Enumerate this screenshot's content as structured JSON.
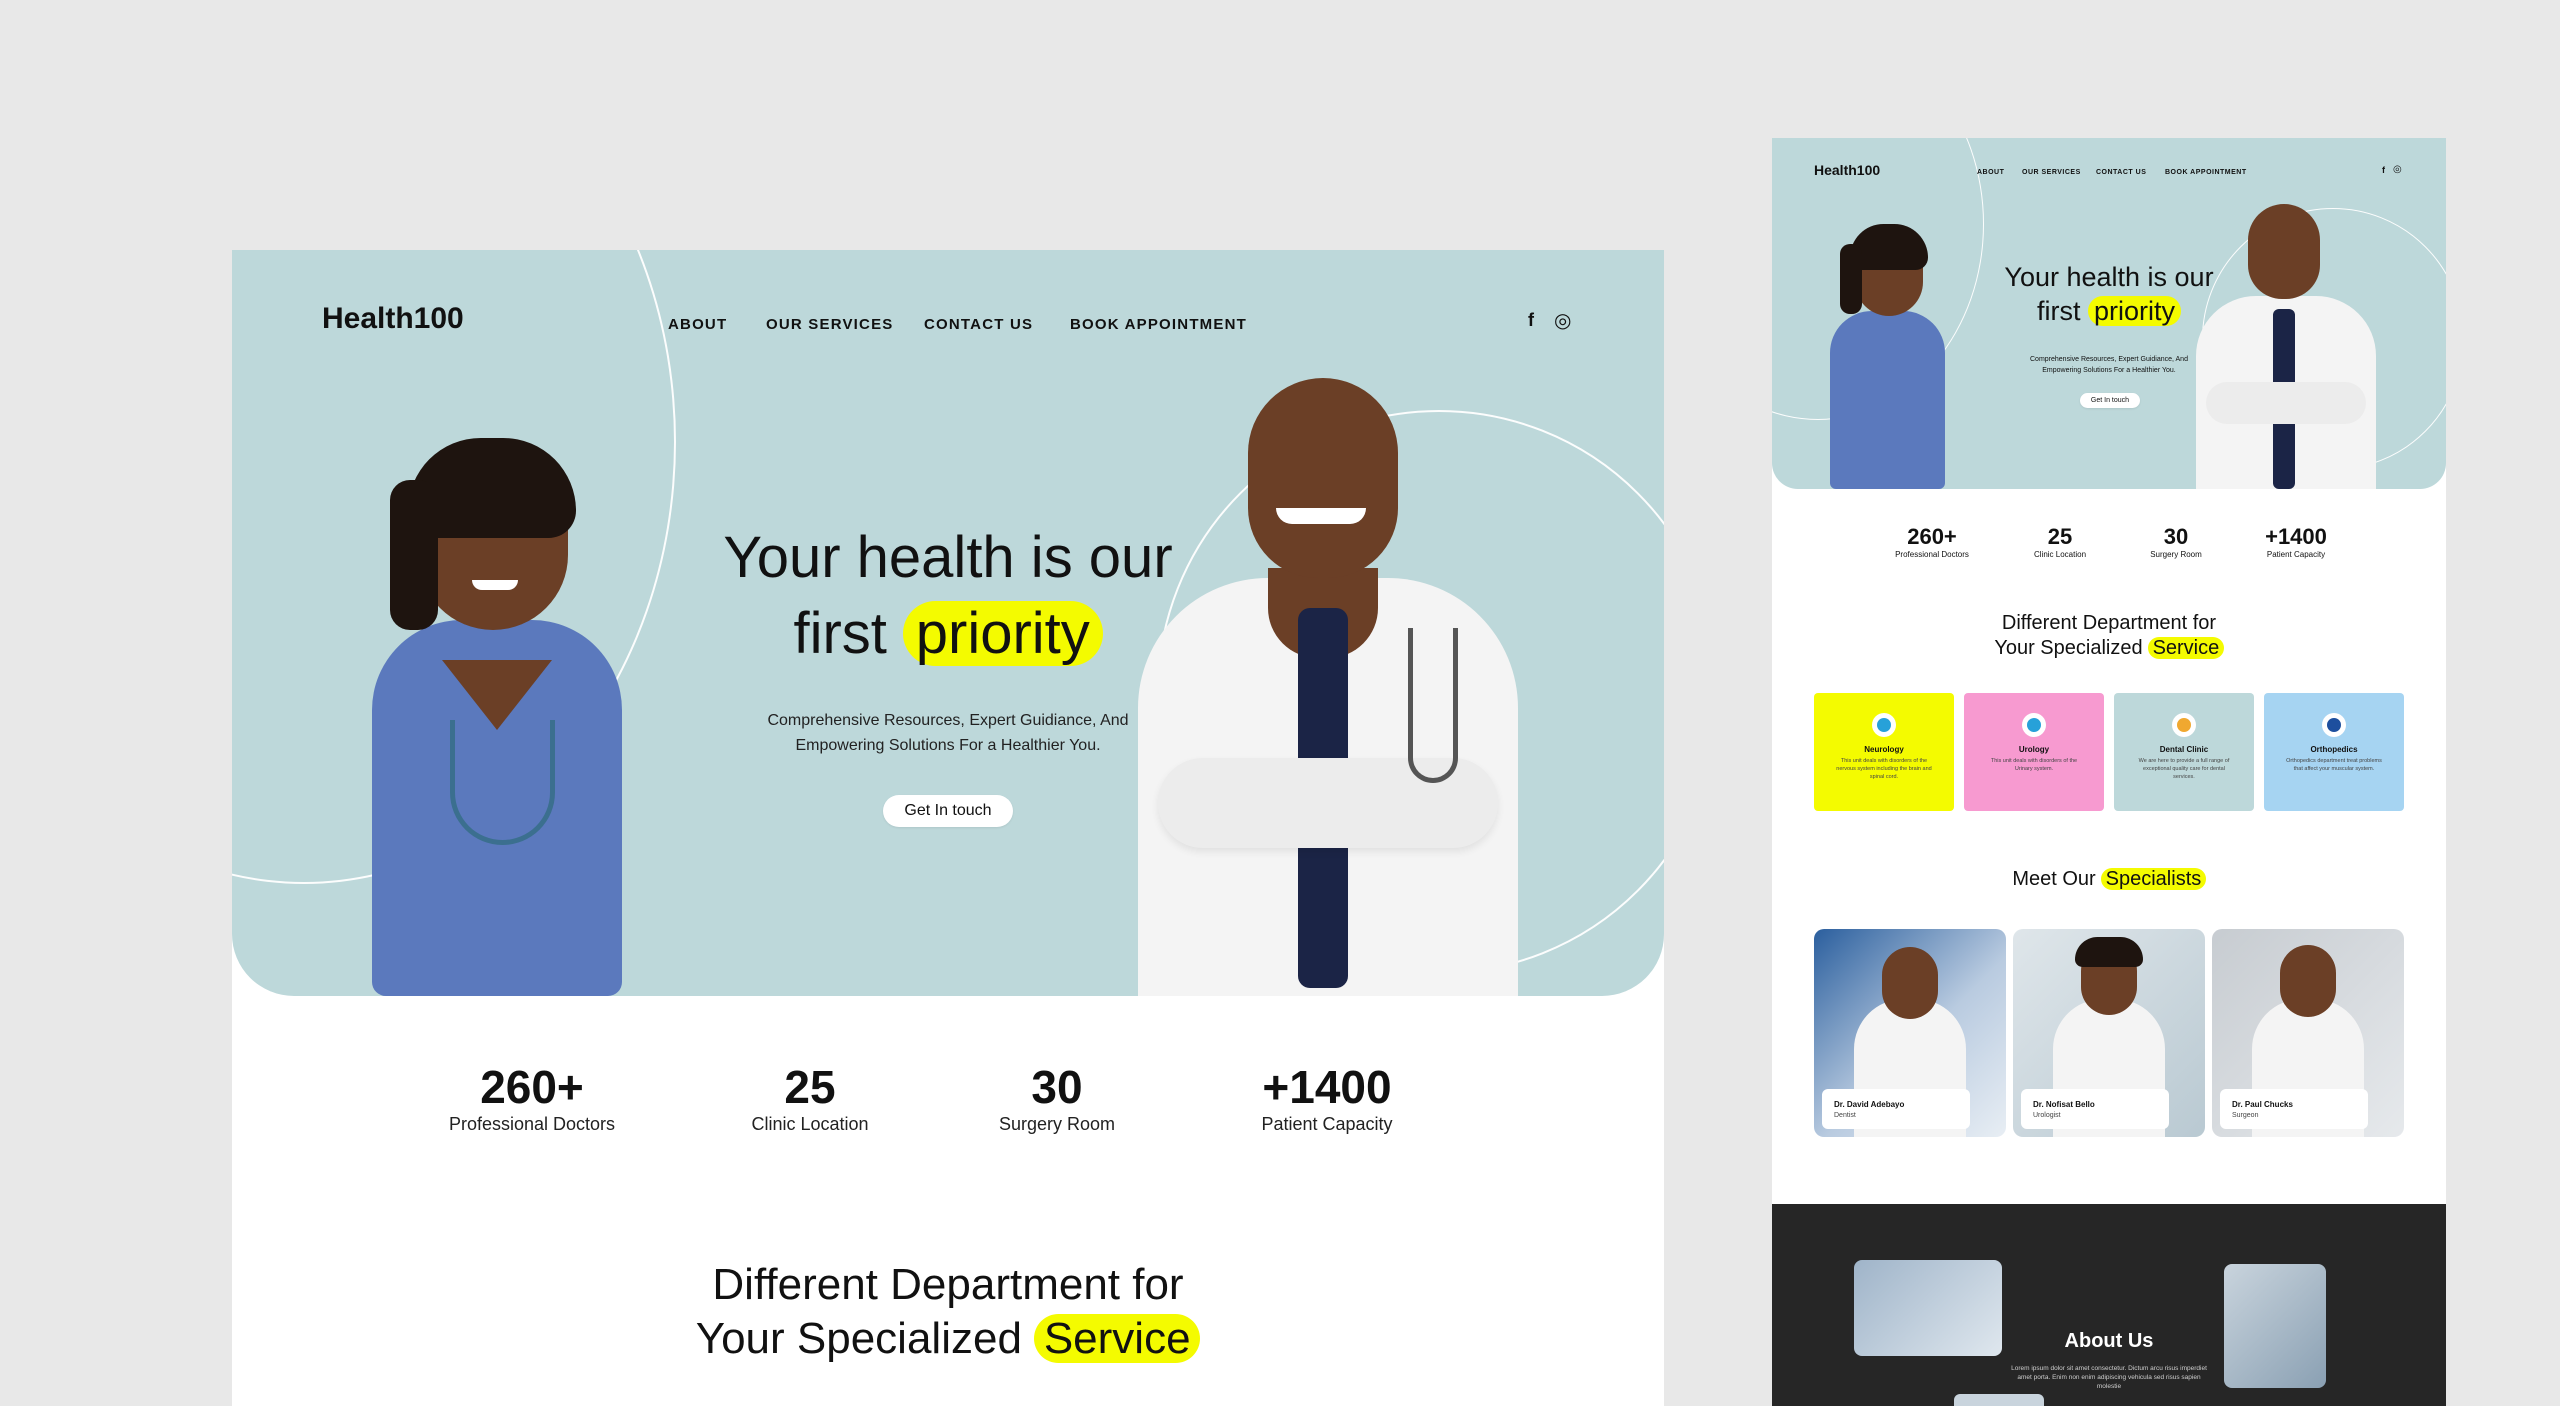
{
  "brand": {
    "name": "Health100"
  },
  "nav": {
    "about": "ABOUT",
    "services": "OUR SERVICES",
    "contact": "CONTACT US",
    "book": "BOOK APPOINTMENT"
  },
  "social": {
    "facebook": "f",
    "instagram": "◎"
  },
  "hero": {
    "title_line1": "Your health is our",
    "title_line2_pre": "first",
    "title_highlight": "priority",
    "subtitle_line1": "Comprehensive Resources, Expert Guidiance, And",
    "subtitle_line2": "Empowering Solutions For a Healthier You.",
    "cta": "Get In touch"
  },
  "stats": [
    {
      "value": "260+",
      "label": "Professional Doctors"
    },
    {
      "value": "25",
      "label": "Clinic Location"
    },
    {
      "value": "30",
      "label": "Surgery Room"
    },
    {
      "value": "+1400",
      "label": "Patient Capacity"
    }
  ],
  "departments_section": {
    "title_line1": "Different Department for",
    "title_line2_pre": "Your Specialized",
    "title_highlight": "Service"
  },
  "departments": [
    {
      "name": "Neurology",
      "desc": "This unit deals with disorders of the nervous system including the brain and spinal cord.",
      "color": "#f4fb00",
      "icon_color": "#27a1d9"
    },
    {
      "name": "Urology",
      "desc": "This unit deals with disorders of the Urinary system.",
      "color": "#f79ad0",
      "icon_color": "#27a1d9"
    },
    {
      "name": "Dental Clinic",
      "desc": "We are here to provide a full range of exceptional quality care for dental services.",
      "color": "#bdd8da",
      "icon_color": "#f0a830"
    },
    {
      "name": "Orthopedics",
      "desc": "Orthopedics department treat problems that affect your muscular system.",
      "color": "#a6d4f2",
      "icon_color": "#1d4f9e"
    }
  ],
  "specialists_section": {
    "title_pre": "Meet Our",
    "title_highlight": "Specialists"
  },
  "specialists": [
    {
      "name": "Dr. David Adebayo",
      "role": "Dentist"
    },
    {
      "name": "Dr. Nofisat Bello",
      "role": "Urologist"
    },
    {
      "name": "Dr. Paul Chucks",
      "role": "Surgeon"
    }
  ],
  "about_section": {
    "title": "About Us",
    "text": "Lorem ipsum dolor sit amet consectetur. Dictum arcu risus imperdiet amet porta. Enim non enim adipiscing vehicula sed risus sapien molestie"
  },
  "colors": {
    "hero_bg": "#bdd8da",
    "highlight": "#f4fb00",
    "page_bg": "#e8e8e8",
    "footer_dark": "#262626"
  }
}
